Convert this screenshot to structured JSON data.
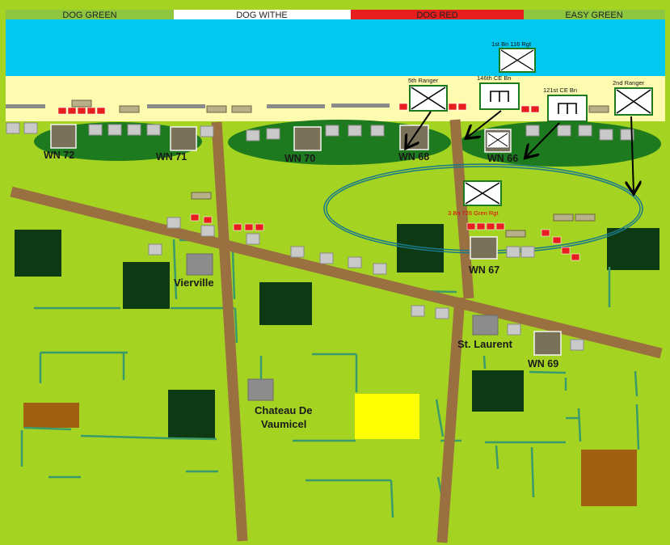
{
  "beach_sectors": [
    {
      "label": "DOG GREEN",
      "color": "#8ec63f"
    },
    {
      "label": "DOG  WITHE",
      "color": "#ffffff"
    },
    {
      "label": "DOG  RED",
      "color": "#e81e1e"
    },
    {
      "label": "EASY GREEN",
      "color": "#8ec63f"
    }
  ],
  "strongpoints": [
    "WN 72",
    "WN 71",
    "WN 70",
    "WN 68",
    "WN 66",
    "WN 67",
    "WN 69"
  ],
  "places": {
    "vierville": "Vierville",
    "st_laurent": "St. Laurent",
    "chateau_line1": "Chateau De",
    "chateau_line2": "Vaumicel"
  },
  "units": {
    "u116": "1st Bn 116 Rgt",
    "u5th": "5th Ranger",
    "u146": "146th CE Bn",
    "u121": "121st CE Bn",
    "u2nd": "2nd Ranger",
    "u726": "3 Bn 726 Gren Rgt"
  },
  "colors": {
    "sea": "#00c8f0",
    "sand": "#fdfbb0",
    "field": "#a5d321",
    "bluff": "#1e7a1e",
    "road": "#9a7040",
    "forest": "#0d3a12",
    "enemy_text": "#e00000"
  }
}
